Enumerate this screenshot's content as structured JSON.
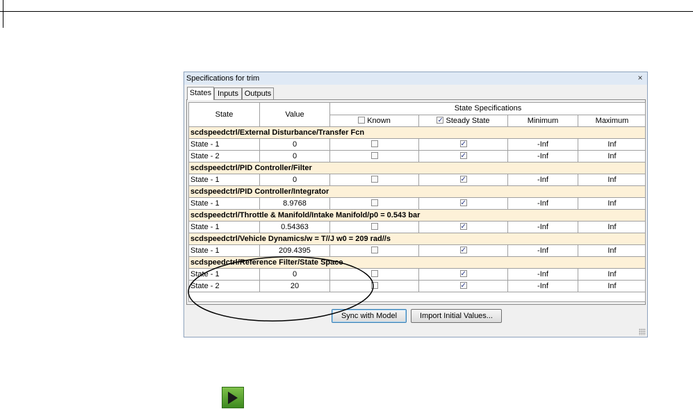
{
  "dialog": {
    "title": "Specifications for trim",
    "close_glyph": "×",
    "tabs": [
      {
        "label": "States",
        "active": true
      },
      {
        "label": "Inputs",
        "active": false
      },
      {
        "label": "Outputs",
        "active": false
      }
    ],
    "table": {
      "headers": {
        "state": "State",
        "value": "Value",
        "state_specifications": "State Specifications",
        "known": "Known",
        "steady_state": "Steady State",
        "minimum": "Minimum",
        "maximum": "Maximum"
      },
      "header_checks": {
        "known": false,
        "steady_state": true
      },
      "rows": [
        {
          "type": "group",
          "label": "scdspeedctrl/External Disturbance/Transfer Fcn"
        },
        {
          "type": "state",
          "state": "State - 1",
          "value": "0",
          "known": false,
          "steady": true,
          "min": "-Inf",
          "max": "Inf"
        },
        {
          "type": "state",
          "state": "State - 2",
          "value": "0",
          "known": false,
          "steady": true,
          "min": "-Inf",
          "max": "Inf"
        },
        {
          "type": "group",
          "label": "scdspeedctrl/PID Controller/Filter"
        },
        {
          "type": "state",
          "state": "State - 1",
          "value": "0",
          "known": false,
          "steady": true,
          "min": "-Inf",
          "max": "Inf"
        },
        {
          "type": "group",
          "label": "scdspeedctrl/PID Controller/Integrator"
        },
        {
          "type": "state",
          "state": "State - 1",
          "value": "8.9768",
          "known": false,
          "steady": true,
          "min": "-Inf",
          "max": "Inf"
        },
        {
          "type": "group",
          "label": "scdspeedctrl/Throttle & Manifold/Intake Manifold/p0 = 0.543 bar"
        },
        {
          "type": "state",
          "state": "State - 1",
          "value": "0.54363",
          "known": false,
          "steady": true,
          "min": "-Inf",
          "max": "Inf"
        },
        {
          "type": "group",
          "label": "scdspeedctrl/Vehicle Dynamics/w = T//J w0 = 209 rad//s"
        },
        {
          "type": "state",
          "state": "State - 1",
          "value": "209.4395",
          "known": false,
          "steady": true,
          "min": "-Inf",
          "max": "Inf"
        },
        {
          "type": "group",
          "label": "scdspeedctrl/Reference Filter/State Space"
        },
        {
          "type": "state",
          "state": "State - 1",
          "value": "0",
          "known": false,
          "steady": true,
          "min": "-Inf",
          "max": "Inf"
        },
        {
          "type": "state",
          "state": "State - 2",
          "value": "20",
          "known": false,
          "steady": true,
          "min": "-Inf",
          "max": "Inf"
        }
      ]
    },
    "buttons": {
      "sync": "Sync with Model",
      "import": "Import Initial Values..."
    }
  },
  "annotation": {
    "shape": "ellipse",
    "color": "#000000"
  },
  "run_icon": {
    "name": "run-play-icon",
    "color": "#4a9c28"
  }
}
